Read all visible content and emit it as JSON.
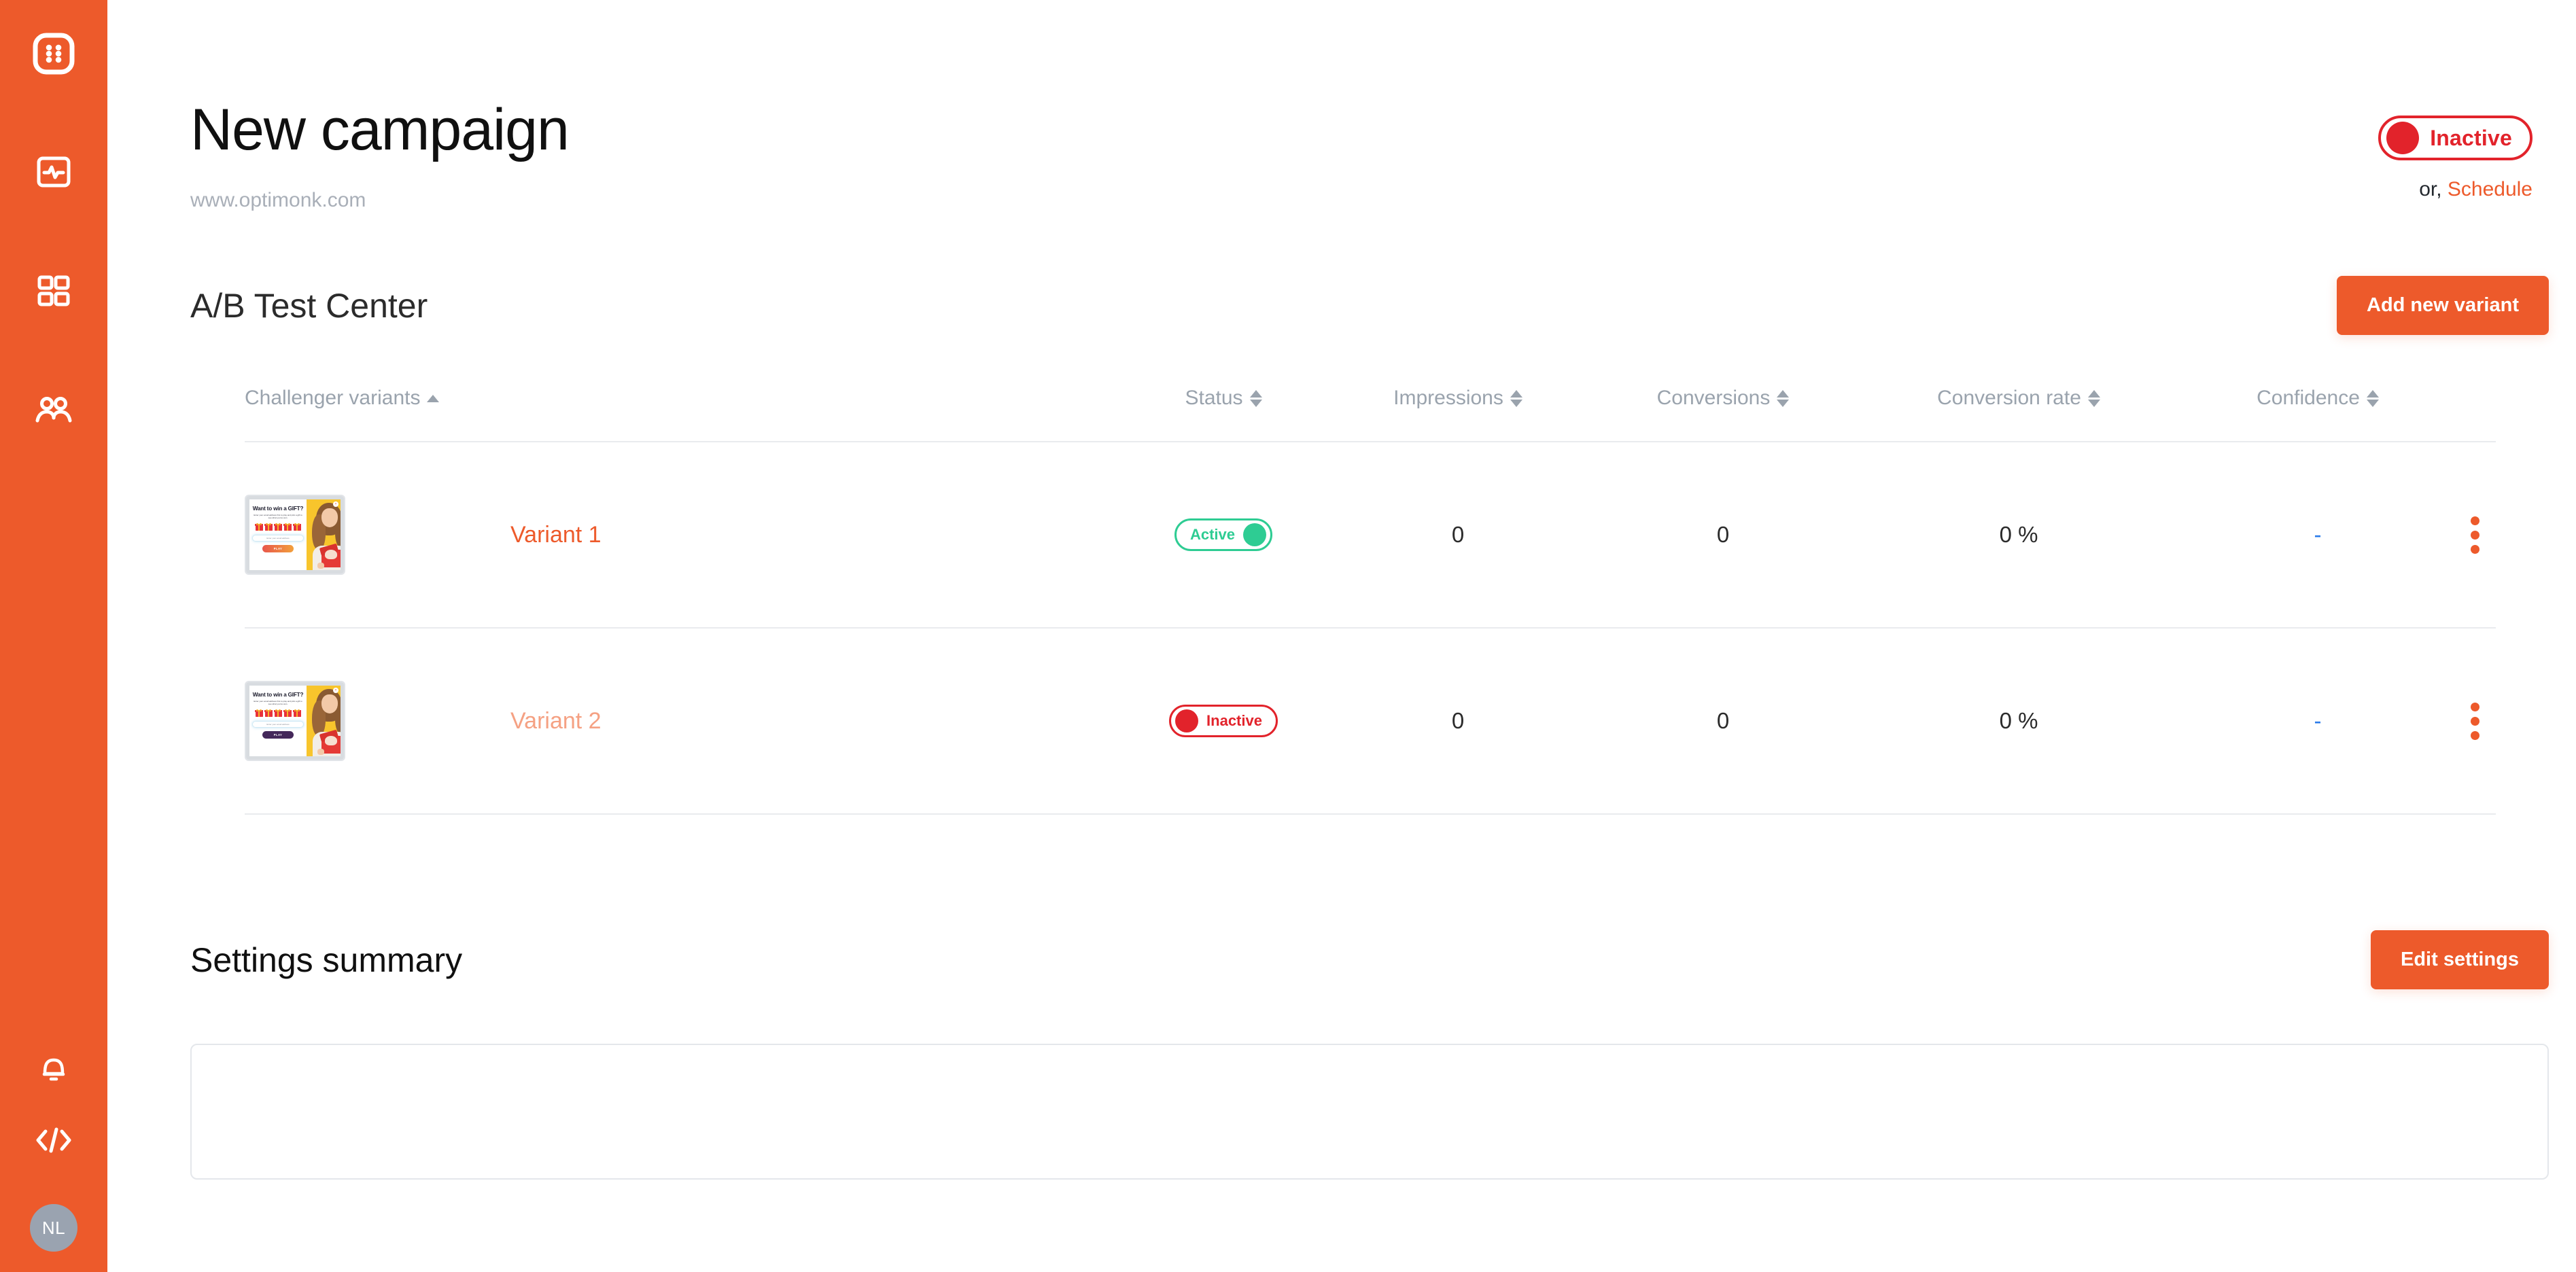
{
  "sidebar": {
    "logo": {
      "icon": "optimonk-logo-icon"
    },
    "items": [
      {
        "icon": "activity-pulse-icon",
        "name": "sidebar-item-dashboard"
      },
      {
        "icon": "grid-squares-icon",
        "name": "sidebar-item-campaigns"
      },
      {
        "icon": "users-icon",
        "name": "sidebar-item-audience"
      }
    ],
    "bottom": [
      {
        "icon": "bell-icon",
        "name": "sidebar-item-notifications"
      },
      {
        "icon": "code-icon",
        "name": "sidebar-item-embed-code"
      }
    ],
    "avatar_initials": "NL"
  },
  "header": {
    "title": "New campaign",
    "subtitle": "www.optimonk.com",
    "status_toggle": {
      "label": "Inactive",
      "state": "inactive",
      "color": "#E2232B"
    },
    "or_text": "or,",
    "schedule_link": "Schedule"
  },
  "ab_test": {
    "section_title": "A/B Test Center",
    "add_variant_label": "Add new variant",
    "columns": [
      {
        "label": "Challenger variants",
        "sort": "asc"
      },
      {
        "label": "Status",
        "sort": "both"
      },
      {
        "label": "Impressions",
        "sort": "both"
      },
      {
        "label": "Conversions",
        "sort": "both"
      },
      {
        "label": "Conversion rate",
        "sort": "both"
      },
      {
        "label": "Confidence",
        "sort": "both"
      }
    ],
    "rows": [
      {
        "name": "Variant 1",
        "status": {
          "label": "Active",
          "state": "active",
          "color": "#2ECC93"
        },
        "impressions": "0",
        "conversions": "0",
        "conversion_rate": "0 %",
        "confidence": "-",
        "menu_icon": "kebab-menu-icon",
        "thumbnail": {
          "title": "Want to win a GIFT?",
          "subtitle": "Enter your email address first to play and pick a gift to see what you've won.",
          "input_placeholder": "Enter your email address",
          "button_label": "PLAY",
          "button_style": "orange",
          "close_icon": "close-icon"
        }
      },
      {
        "name": "Variant 2",
        "status": {
          "label": "Inactive",
          "state": "inactive",
          "color": "#E2232B"
        },
        "impressions": "0",
        "conversions": "0",
        "conversion_rate": "0 %",
        "confidence": "-",
        "menu_icon": "kebab-menu-icon",
        "thumbnail": {
          "title": "Want to win a GIFT?",
          "subtitle": "Enter your email address first to play and pick a gift to see what you've won.",
          "input_placeholder": "Enter your email address",
          "button_label": "PLAY",
          "button_style": "purple",
          "close_icon": "close-icon"
        }
      }
    ]
  },
  "settings": {
    "title": "Settings summary",
    "edit_label": "Edit settings"
  },
  "colors": {
    "brand_orange": "#ED5A2B",
    "danger_red": "#E2232B",
    "success_green": "#2ECC93",
    "muted_gray": "#9AA3AD"
  }
}
